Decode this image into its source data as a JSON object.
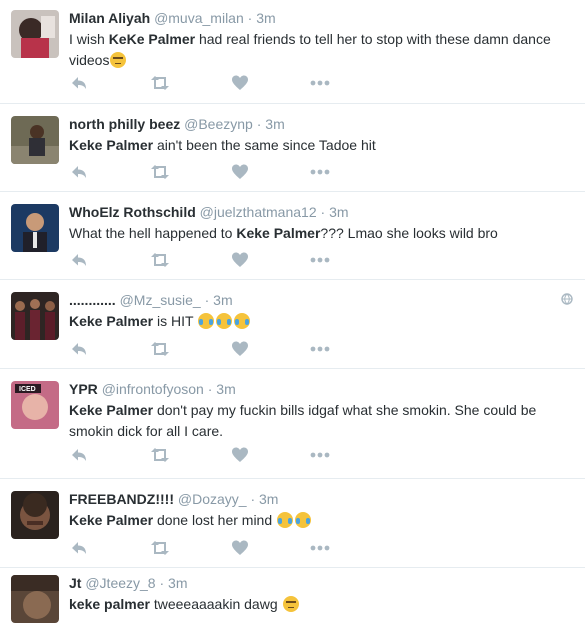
{
  "tweets": [
    {
      "name": "Milan Aliyah",
      "handle": "@muva_milan",
      "dot": "·",
      "time": "3m",
      "text_parts": [
        "I wish ",
        "KeKe Palmer",
        " had real friends to tell her to stop with these damn dance videos"
      ],
      "emojis": [
        "unamused-face"
      ]
    },
    {
      "name": "north philly beez",
      "handle": "@Beezynp",
      "dot": "·",
      "time": "3m",
      "text_parts": [
        "",
        "Keke Palmer",
        " ain't been the same since Tadoe hit"
      ],
      "emojis": []
    },
    {
      "name": "WhoElz Rothschild",
      "handle": "@juelzthatmana12",
      "dot": "·",
      "time": "3m",
      "text_parts": [
        "What the hell happened to ",
        "Keke Palmer",
        "??? Lmao she looks wild bro"
      ],
      "emojis": []
    },
    {
      "name": "............",
      "handle": "@Mz_susie_",
      "dot": "·",
      "time": "3m",
      "text_parts": [
        "",
        "Keke Palmer",
        " is HIT "
      ],
      "emojis": [
        "tears-of-joy",
        "tears-of-joy",
        "tears-of-joy"
      ],
      "globe_icon": "globe-icon"
    },
    {
      "name": "YPR",
      "handle": "@infrontofyoson",
      "dot": "·",
      "time": "3m",
      "text_parts": [
        "",
        "Keke Palmer",
        " don't pay my fuckin bills idgaf what she smokin. She could be smokin dick for all I care."
      ],
      "emojis": [],
      "avatar_text": "ICED"
    },
    {
      "name": "FREEBANDZ!!!!",
      "handle": "@Dozayy_",
      "dot": "·",
      "time": "3m",
      "text_parts": [
        "",
        "Keke Palmer",
        " done lost her mind "
      ],
      "emojis": [
        "loudly-crying-face",
        "loudly-crying-face"
      ]
    },
    {
      "name": "Jt",
      "handle": "@Jteezy_8",
      "dot": "·",
      "time": "3m",
      "text_parts": [
        "",
        "keke palmer",
        " tweeeaaaakin dawg "
      ],
      "emojis": [
        "grimacing-face"
      ]
    }
  ],
  "actions": [
    "reply-icon",
    "retweet-icon",
    "like-icon",
    "more-icon"
  ],
  "colors": {
    "name": "#292f33",
    "meta": "#8899a6",
    "icon": "#aab8c2",
    "divider": "#e6ecf0"
  }
}
